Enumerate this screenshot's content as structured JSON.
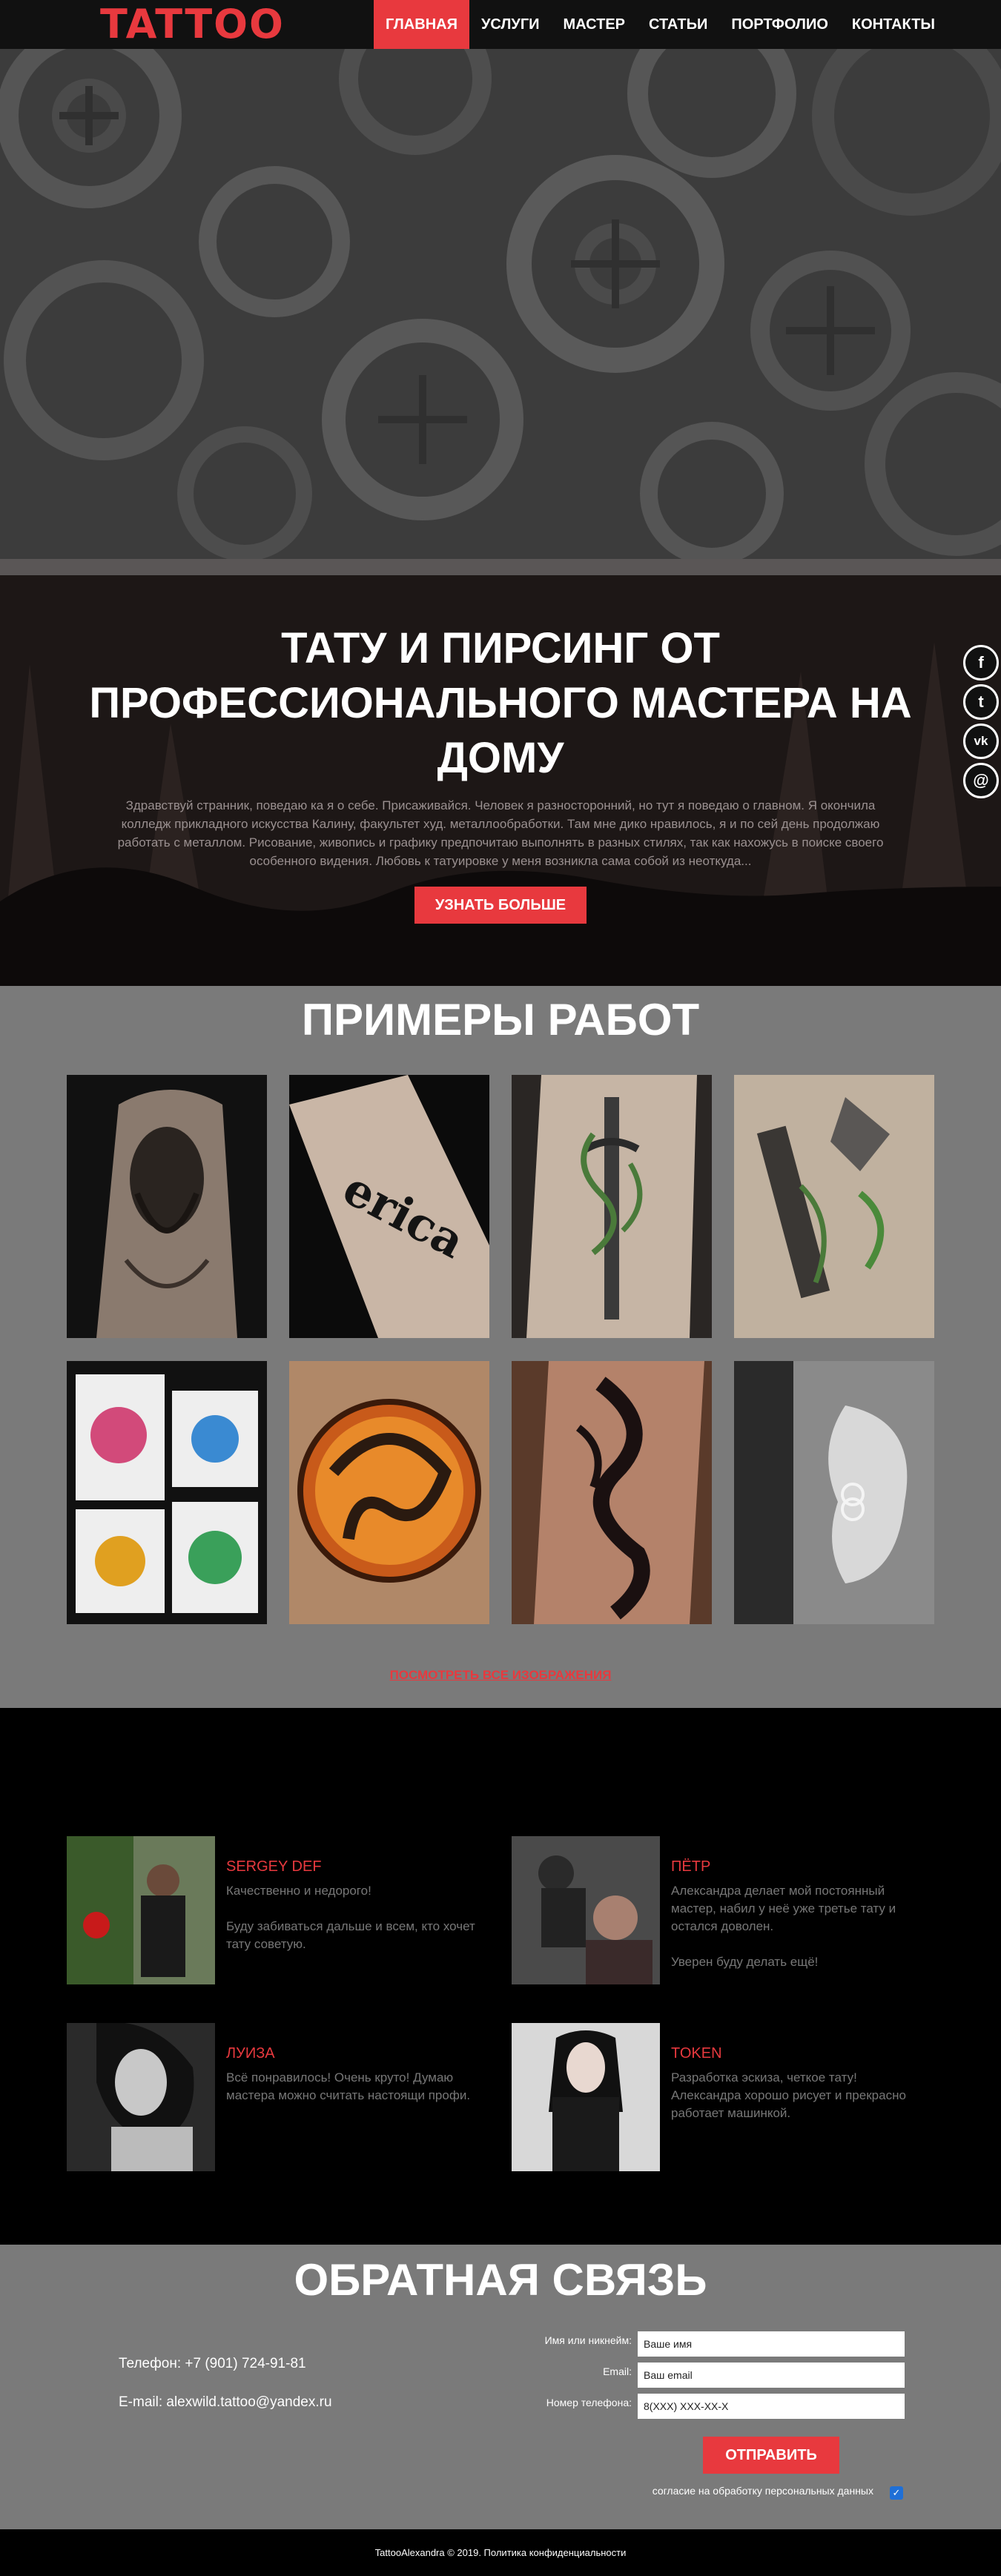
{
  "header": {
    "logo": "TATTOO",
    "nav": [
      {
        "label": "ГЛАВНАЯ",
        "active": true
      },
      {
        "label": "УСЛУГИ",
        "active": false
      },
      {
        "label": "МАСТЕР",
        "active": false
      },
      {
        "label": "СТАТЬИ",
        "active": false
      },
      {
        "label": "ПОРТФОЛИО",
        "active": false
      },
      {
        "label": "КОНТАКТЫ",
        "active": false
      }
    ]
  },
  "hero": {
    "title": "ТАТУ И ПИРСИНГ ОТ\nПРОФЕССИОНАЛЬНОГО МАСТЕРА НА\nДОМУ",
    "text": "Здравствуй странник, поведаю ка я о себе. Присаживайся. Человек я разносторонний, но тут я поведаю о главном. Я окончила колледж прикладного искусства Калину, факультет худ. металлообработки. Там мне дико нравилось, я и по сей день продолжаю работать с металлом. Рисование, живопись и графику предпочитаю выполнять в разных стилях, так как нахожусь в поиске своего особенного видения. Любовь к татуировке у меня возникла сама собой из неоткуда...",
    "button": "УЗНАТЬ БОЛЬШЕ"
  },
  "social": [
    {
      "icon": "facebook-icon",
      "glyph": "f"
    },
    {
      "icon": "twitter-icon",
      "glyph": "t"
    },
    {
      "icon": "vk-icon",
      "glyph": "vk"
    },
    {
      "icon": "email-icon",
      "glyph": "@"
    }
  ],
  "works": {
    "title": "ПРИМЕРЫ РАБОТ",
    "link": "ПОСМОТРЕТЬ ВСЕ ИЗОБРАЖЕНИЯ",
    "tiles": [
      "tattoo-photo-1",
      "tattoo-photo-2",
      "tattoo-photo-3",
      "tattoo-photo-4",
      "tattoo-photo-5",
      "tattoo-photo-6",
      "tattoo-photo-7",
      "tattoo-photo-8"
    ]
  },
  "reviews": [
    {
      "name": "SERGEY DEF",
      "text": "Качественно и недорого!\n\nБуду забиваться дальше и всем, кто хочет тату советую."
    },
    {
      "name": "ПЁТР",
      "text": "Александра делает мой постоянный мастер, набил у неё уже третье тату и остался доволен.\n\nУверен буду делать ещё!"
    },
    {
      "name": "ЛУИЗА",
      "text": "Всё понравилось! Очень круто! Думаю мастера можно считать настоящи профи."
    },
    {
      "name": "TOKEN",
      "text": "Разработка эскиза, четкое тату! Александра хорошо рисует и прекрасно работает машинкой."
    }
  ],
  "feedback": {
    "title": "ОБРАТНАЯ СВЯЗЬ",
    "phone": "Телефон: +7 (901) 724-91-81",
    "email": "E-mail: alexwild.tattoo@yandex.ru",
    "name_label": "Имя или никнейм:",
    "name_value": "Ваше имя",
    "email_label": "Email:",
    "email_value": "Ваш email",
    "phone_label": "Номер телефона:",
    "phone_value": "8(XXX) XXX-XX-X",
    "button": "ОТПРАВИТЬ",
    "consent": "согласие на обработку персональных данных",
    "consent_checked": true
  },
  "footer": {
    "text": "TattooAlexandra © 2019. Политика конфиденциальности"
  },
  "colors": {
    "accent": "#e8393e",
    "gray_section": "#7a7a7a",
    "dark": "#000000"
  }
}
